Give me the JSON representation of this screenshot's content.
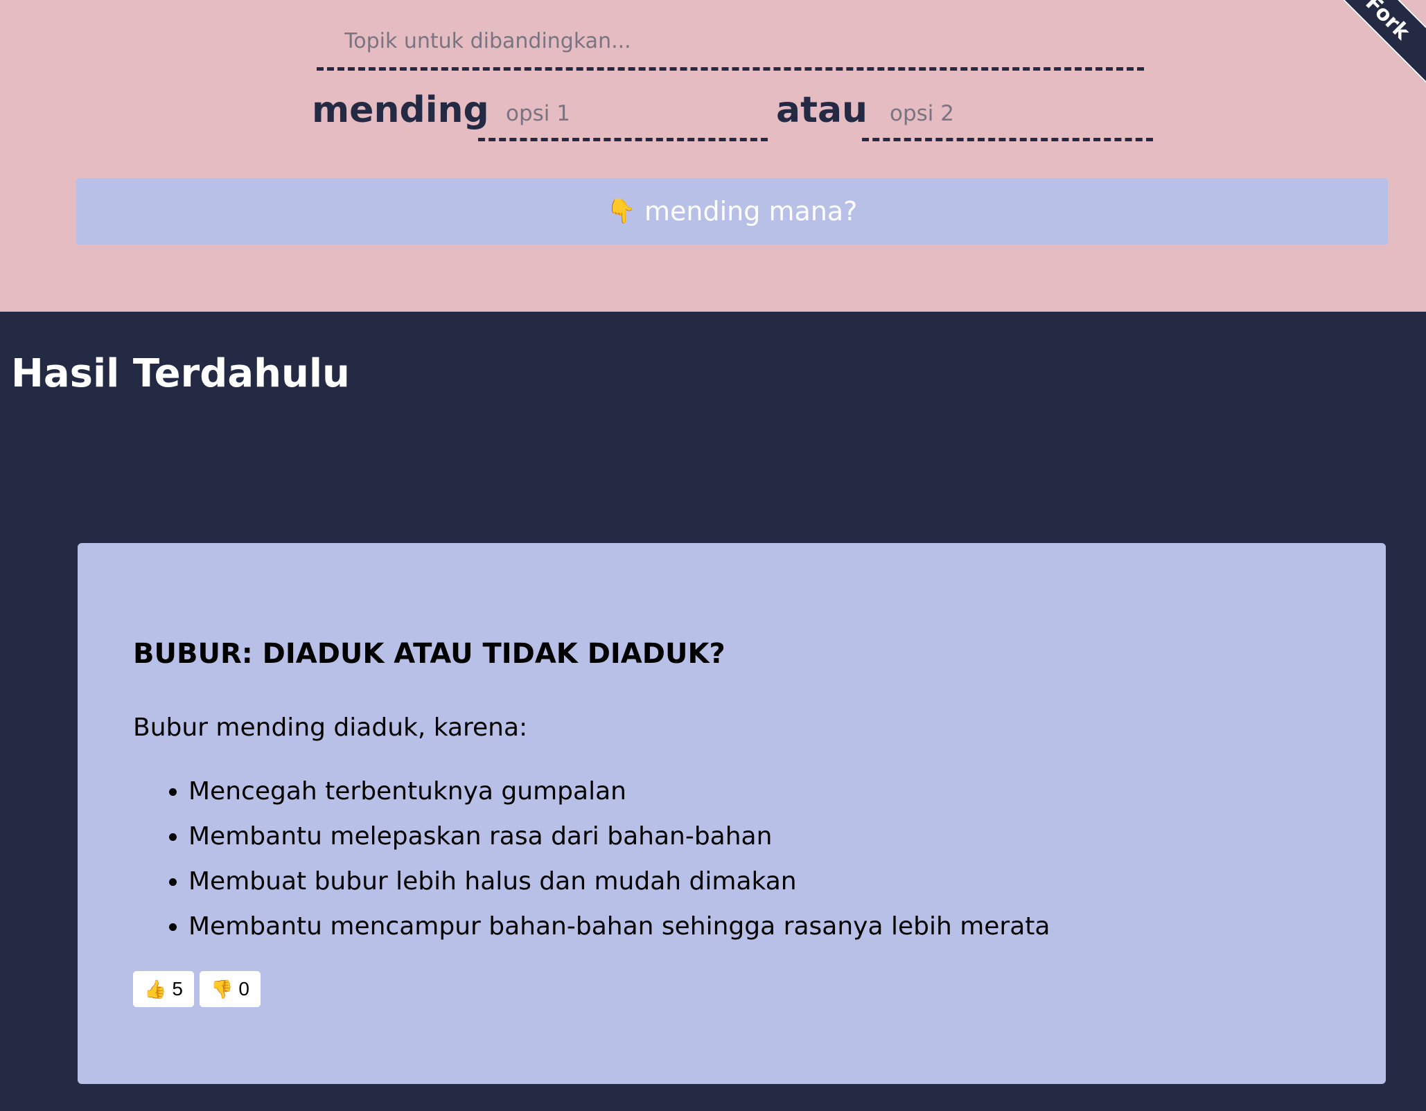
{
  "form": {
    "topic_placeholder": "Topik untuk dibandingkan...",
    "word_mending": "mending",
    "option1_placeholder": "opsi 1",
    "word_atau": "atau",
    "option2_placeholder": "opsi 2",
    "submit_icon": "👇",
    "submit_label": "mending mana?"
  },
  "fork_ribbon": "Fork",
  "history": {
    "title": "Hasil Terdahulu",
    "cards": [
      {
        "title": "BUBUR: DIADUK ATAU TIDAK DIADUK?",
        "intro": "Bubur mending diaduk, karena:",
        "reasons": [
          "Mencegah terbentuknya gumpalan",
          "Membantu melepaskan rasa dari bahan-bahan",
          "Membuat bubur lebih halus dan mudah dimakan",
          "Membantu mencampur bahan-bahan sehingga rasanya lebih merata"
        ],
        "upvote_icon": "👍",
        "upvotes": "5",
        "downvote_icon": "👎",
        "downvotes": "0"
      }
    ]
  },
  "colors": {
    "top_bg": "#e6bcc3",
    "page_bg": "#242944",
    "accent": "#b8c0e8"
  }
}
